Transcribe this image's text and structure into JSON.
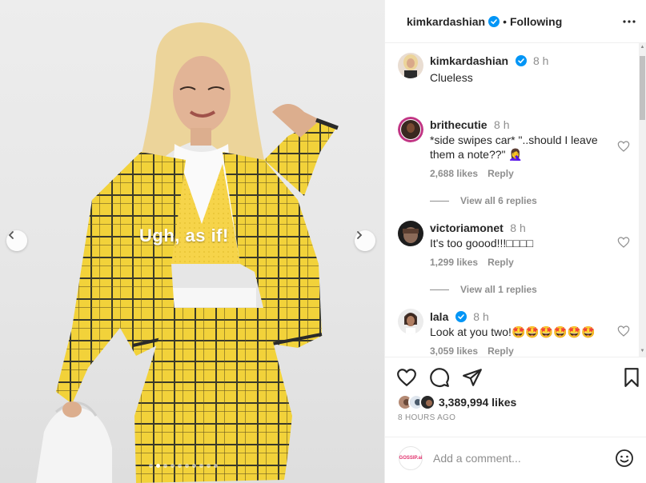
{
  "post": {
    "overlay_text": "Ugh, as if!",
    "carousel_dots": 10,
    "active_dot": 1
  },
  "header": {
    "username": "kimkardashian",
    "separator": "•",
    "follow_status": "Following"
  },
  "caption": {
    "username": "kimkardashian",
    "time": "8 h",
    "text": "Clueless"
  },
  "comments": [
    {
      "username": "brithecutie",
      "time": "8 h",
      "text": "*side swipes car* \"..should I leave them a note??\" 🤦‍♀️",
      "likes": "2,688 likes",
      "reply": "Reply",
      "view_replies": "View all 6 replies"
    },
    {
      "username": "victoriamonet",
      "time": "8 h",
      "text": "It's too goood!!!□□□□",
      "likes": "1,299 likes",
      "reply": "Reply",
      "view_replies": "View all 1 replies"
    },
    {
      "username": "lala",
      "time": "8 h",
      "text": "Look at you two!🤩🤩🤩🤩🤩🤩",
      "likes": "3,059 likes",
      "reply": "Reply"
    }
  ],
  "stats": {
    "likes": "3,389,994 likes",
    "time_ago": "8 HOURS AGO"
  },
  "comment_box": {
    "account_badge": "GOSSIP.ai",
    "placeholder": "Add a comment..."
  },
  "icons": {
    "verified": "verified-badge-icon",
    "more": "more-horizontal-icon",
    "like": "heart-icon",
    "comment": "comment-bubble-icon",
    "share": "paper-plane-icon",
    "save": "bookmark-icon",
    "emoji": "smiley-icon",
    "prev": "chevron-left-icon",
    "next": "chevron-right-icon"
  },
  "colors": {
    "verified_blue": "#0095f6",
    "text_primary": "#262626",
    "text_secondary": "#8e8e8e",
    "plaid_yellow": "#f2d23a"
  }
}
